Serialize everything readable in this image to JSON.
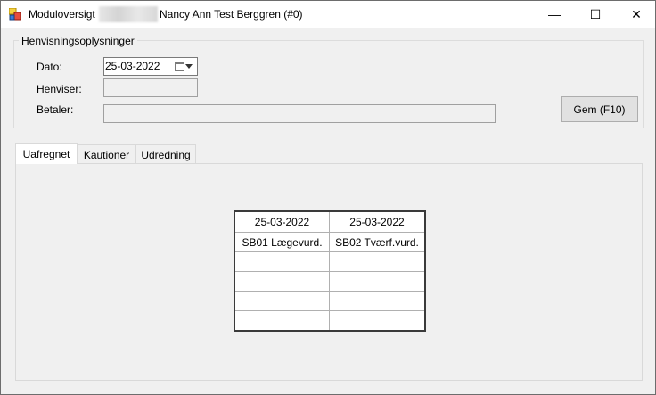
{
  "window": {
    "title_prefix": "Moduloversigt",
    "title_name": "Nancy Ann Test Berggren (#0)",
    "minimize_glyph": "—",
    "maximize_glyph": "☐",
    "close_glyph": "✕"
  },
  "referral": {
    "group_title": "Henvisningsoplysninger",
    "date_label": "Dato:",
    "date_value": "25-03-2022",
    "referrer_label": "Henviser:",
    "referrer_value": "",
    "payer_label": "Betaler:",
    "payer_value": "",
    "save_button": "Gem (F10)"
  },
  "tabs": [
    {
      "label": "Uafregnet",
      "active": true
    },
    {
      "label": "Kautioner",
      "active": false
    },
    {
      "label": "Udredning",
      "active": false
    }
  ],
  "grid": {
    "headers": [
      "25-03-2022",
      "25-03-2022"
    ],
    "rows": [
      [
        "SB01 Lægevurd.",
        "SB02 Tværf.vurd."
      ],
      [
        "",
        ""
      ],
      [
        "",
        ""
      ],
      [
        "",
        ""
      ],
      [
        "",
        ""
      ]
    ]
  }
}
